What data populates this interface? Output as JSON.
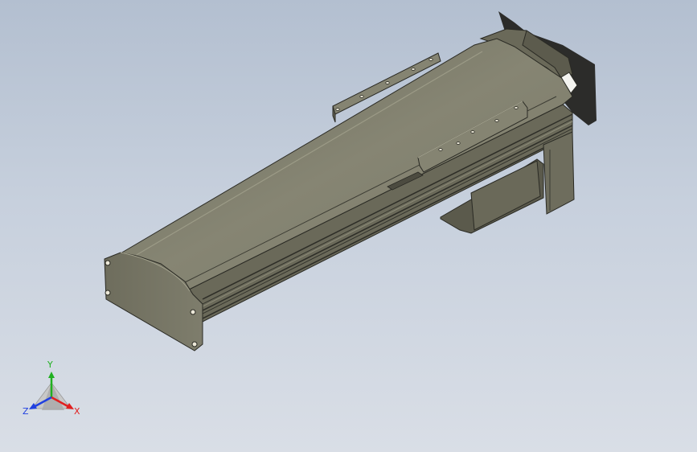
{
  "view": {
    "background_top": "#b3bfd0",
    "background_bottom": "#d9dee6",
    "model_color": "#7c7b6a"
  },
  "triad": {
    "x_label": "X",
    "y_label": "Y",
    "z_label": "Z",
    "x_color": "#e02020",
    "y_color": "#20b020",
    "z_color": "#2040e0"
  }
}
